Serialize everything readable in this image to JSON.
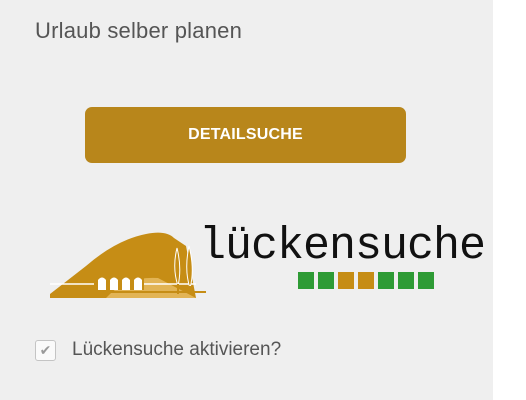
{
  "panel": {
    "title": "Urlaub selber planen"
  },
  "search_button": {
    "label": "DETAILSUCHE",
    "color": "#b8861b"
  },
  "logo": {
    "word": "lückensuche",
    "brand_gold": "#c68d15",
    "square_colors": [
      "#2e9b35",
      "#2e9b35",
      "#c68d15",
      "#c68d15",
      "#2e9b35",
      "#2e9b35",
      "#2e9b35"
    ],
    "icon": "landscape-bridge-logo"
  },
  "activate": {
    "label": "Lückensuche aktivieren?",
    "checked": true,
    "icon": "checkmark-icon"
  }
}
